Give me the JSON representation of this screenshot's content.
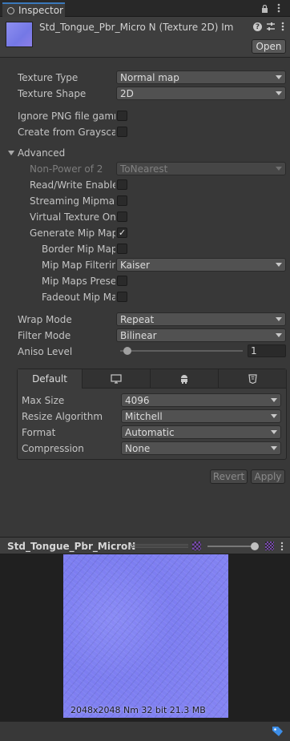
{
  "window": {
    "tab_label": "Inspector"
  },
  "header": {
    "title": "Std_Tongue_Pbr_Micro N (Texture 2D) Im",
    "open_label": "Open"
  },
  "fields": {
    "texture_type": {
      "label": "Texture Type",
      "value": "Normal map"
    },
    "texture_shape": {
      "label": "Texture Shape",
      "value": "2D"
    },
    "ignore_png": {
      "label": "Ignore PNG file gamm",
      "checked": false
    },
    "from_grayscale": {
      "label": "Create from Grayscale",
      "checked": false
    },
    "advanced": {
      "label": "Advanced"
    },
    "non_power": {
      "label": "Non-Power of 2",
      "value": "ToNearest"
    },
    "read_write": {
      "label": "Read/Write Enabled",
      "checked": false
    },
    "streaming": {
      "label": "Streaming Mipmap",
      "checked": false
    },
    "virtual_texture": {
      "label": "Virtual Texture Only",
      "checked": false
    },
    "gen_mip": {
      "label": "Generate Mip Maps",
      "checked": true,
      "mark": "✓"
    },
    "border_mip": {
      "label": "Border Mip Maps",
      "checked": false
    },
    "mip_filter": {
      "label": "Mip Map Filtering",
      "value": "Kaiser"
    },
    "mip_preserve": {
      "label": "Mip Maps Preserve",
      "checked": false
    },
    "fadeout": {
      "label": "Fadeout Mip Maps",
      "checked": false
    },
    "wrap_mode": {
      "label": "Wrap Mode",
      "value": "Repeat"
    },
    "filter_mode": {
      "label": "Filter Mode",
      "value": "Bilinear"
    },
    "aniso": {
      "label": "Aniso Level",
      "value": "1",
      "slider_fraction": 0.0
    }
  },
  "platform": {
    "tabs": [
      {
        "label": "Default",
        "icon": ""
      },
      {
        "label": "",
        "icon": "monitor-icon"
      },
      {
        "label": "",
        "icon": "android-icon"
      },
      {
        "label": "",
        "icon": "html5-icon"
      }
    ],
    "max_size": {
      "label": "Max Size",
      "value": "4096"
    },
    "resize": {
      "label": "Resize Algorithm",
      "value": "Mitchell"
    },
    "format": {
      "label": "Format",
      "value": "Automatic"
    },
    "compression": {
      "label": "Compression",
      "value": "None"
    }
  },
  "actions": {
    "revert": "Revert",
    "apply": "Apply"
  },
  "preview": {
    "title": "Std_Tongue_Pbr_MicroN",
    "info": "2048x2048  Nm 32 bit  21.3 MB",
    "mip_slider_fraction": 1.0
  },
  "colors": {
    "accent": "#3a79bb",
    "texture": "#7c7ef0"
  }
}
